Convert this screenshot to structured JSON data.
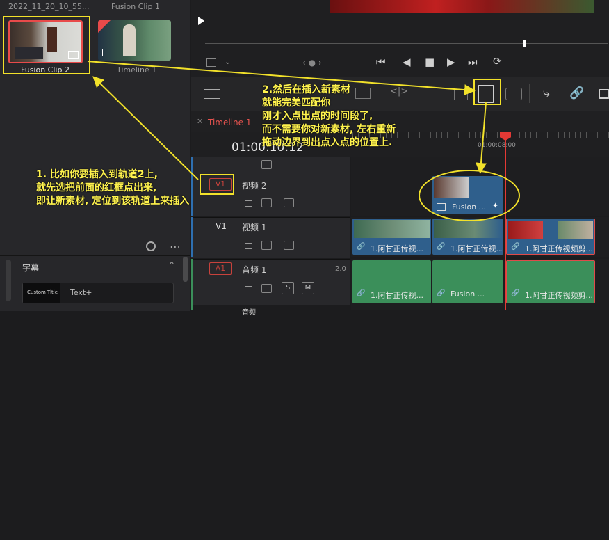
{
  "media_pool": {
    "clips": [
      {
        "top_label": "2022_11_20_10_55...",
        "bottom_label": "Fusion Clip 2"
      },
      {
        "top_label": "Fusion Clip 1",
        "bottom_label": "Timeline 1"
      }
    ]
  },
  "effects": {
    "section_title": "字幕",
    "items": [
      {
        "thumb_label": "Custom Title",
        "label": "Text+"
      }
    ]
  },
  "timeline": {
    "tab_name": "Timeline 1",
    "timecode": "01:00:10:12",
    "ruler_mark": "01:00:08:00",
    "tracks": [
      {
        "tag": "V1",
        "name": "视频 2"
      },
      {
        "tag": "V1",
        "name": "视频 1"
      },
      {
        "tag": "A1",
        "name": "音频 1",
        "level": "2.0",
        "solo": "S",
        "mute": "M"
      },
      {
        "name": "音频"
      }
    ],
    "v2_clip": "Fusion ...",
    "v1_clips": [
      "1.阿甘正传视...",
      "1.阿甘正传视...",
      "1.阿甘正传视频剪..."
    ],
    "a1_clips": [
      "1.阿甘正传视...",
      "Fusion ...",
      "1.阿甘正传视频剪..."
    ]
  },
  "annotations": {
    "left": [
      "1. 比如你要插入到轨道2上,",
      "就先选把前面的红框点出来,",
      "即让新素材, 定位到该轨道上来插入"
    ],
    "right": [
      "2.然后在插入新素材",
      "就能完美匹配你",
      "刚才入点出点的时间段了,",
      "而不需要你对新素材, 左右重新",
      "拖动边界到出点入点的位置上."
    ]
  },
  "colors": {
    "annotation": "#fff34d",
    "playhead": "#e53935",
    "video_clip": "#2f5f8c",
    "audio_clip": "#3b8f5a"
  }
}
